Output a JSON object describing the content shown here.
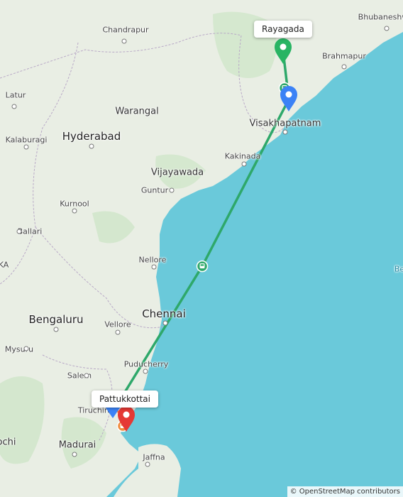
{
  "map": {
    "route_color": "#2ea86a",
    "water_color": "#6ac9da",
    "land_color": "#e9eee4",
    "markers": [
      {
        "name": "start-pin-rayagada",
        "color": "#28b463"
      },
      {
        "name": "via-pin-visakhapatnam",
        "color": "#3b82f6"
      },
      {
        "name": "via-pin-trichy",
        "color": "#3b82f6"
      },
      {
        "name": "end-pin-pattukkottai",
        "color": "#e53935"
      }
    ],
    "icons": [
      "train-icon",
      "train-icon",
      "bus-icon"
    ],
    "callouts": {
      "top": "Rayagada",
      "bottom": "Pattukkottai"
    },
    "cities": {
      "bhubaneswar": "Bhubaneshw",
      "chandrapur": "Chandrapur",
      "brahmapur": "Brahmapur",
      "warangal": "Warangal",
      "latur": "Latur",
      "visakhapatnam": "Visakhapatnam",
      "hyderabad": "Hyderabad",
      "kalaburagi": "Kalaburagi",
      "kakinada": "Kakinada",
      "vijayawada": "Vijayawada",
      "guntur": "Guntur",
      "kurnool": "Kurnool",
      "ballari": "Ballari",
      "nellore": "Nellore",
      "ka_edge": "KA",
      "chennai": "Chennai",
      "bengaluru": "Bengaluru",
      "vellore": "Vellore",
      "mysuru": "Mysuru",
      "puducherry": "Puducherry",
      "salem": "Salem",
      "tiruchirappalli": "Tiruchira",
      "madurai": "Madurai",
      "kochi": "ochi",
      "jaffna": "Jaffna",
      "be_edge": "Be"
    },
    "attribution": "© OpenStreetMap contributors"
  }
}
